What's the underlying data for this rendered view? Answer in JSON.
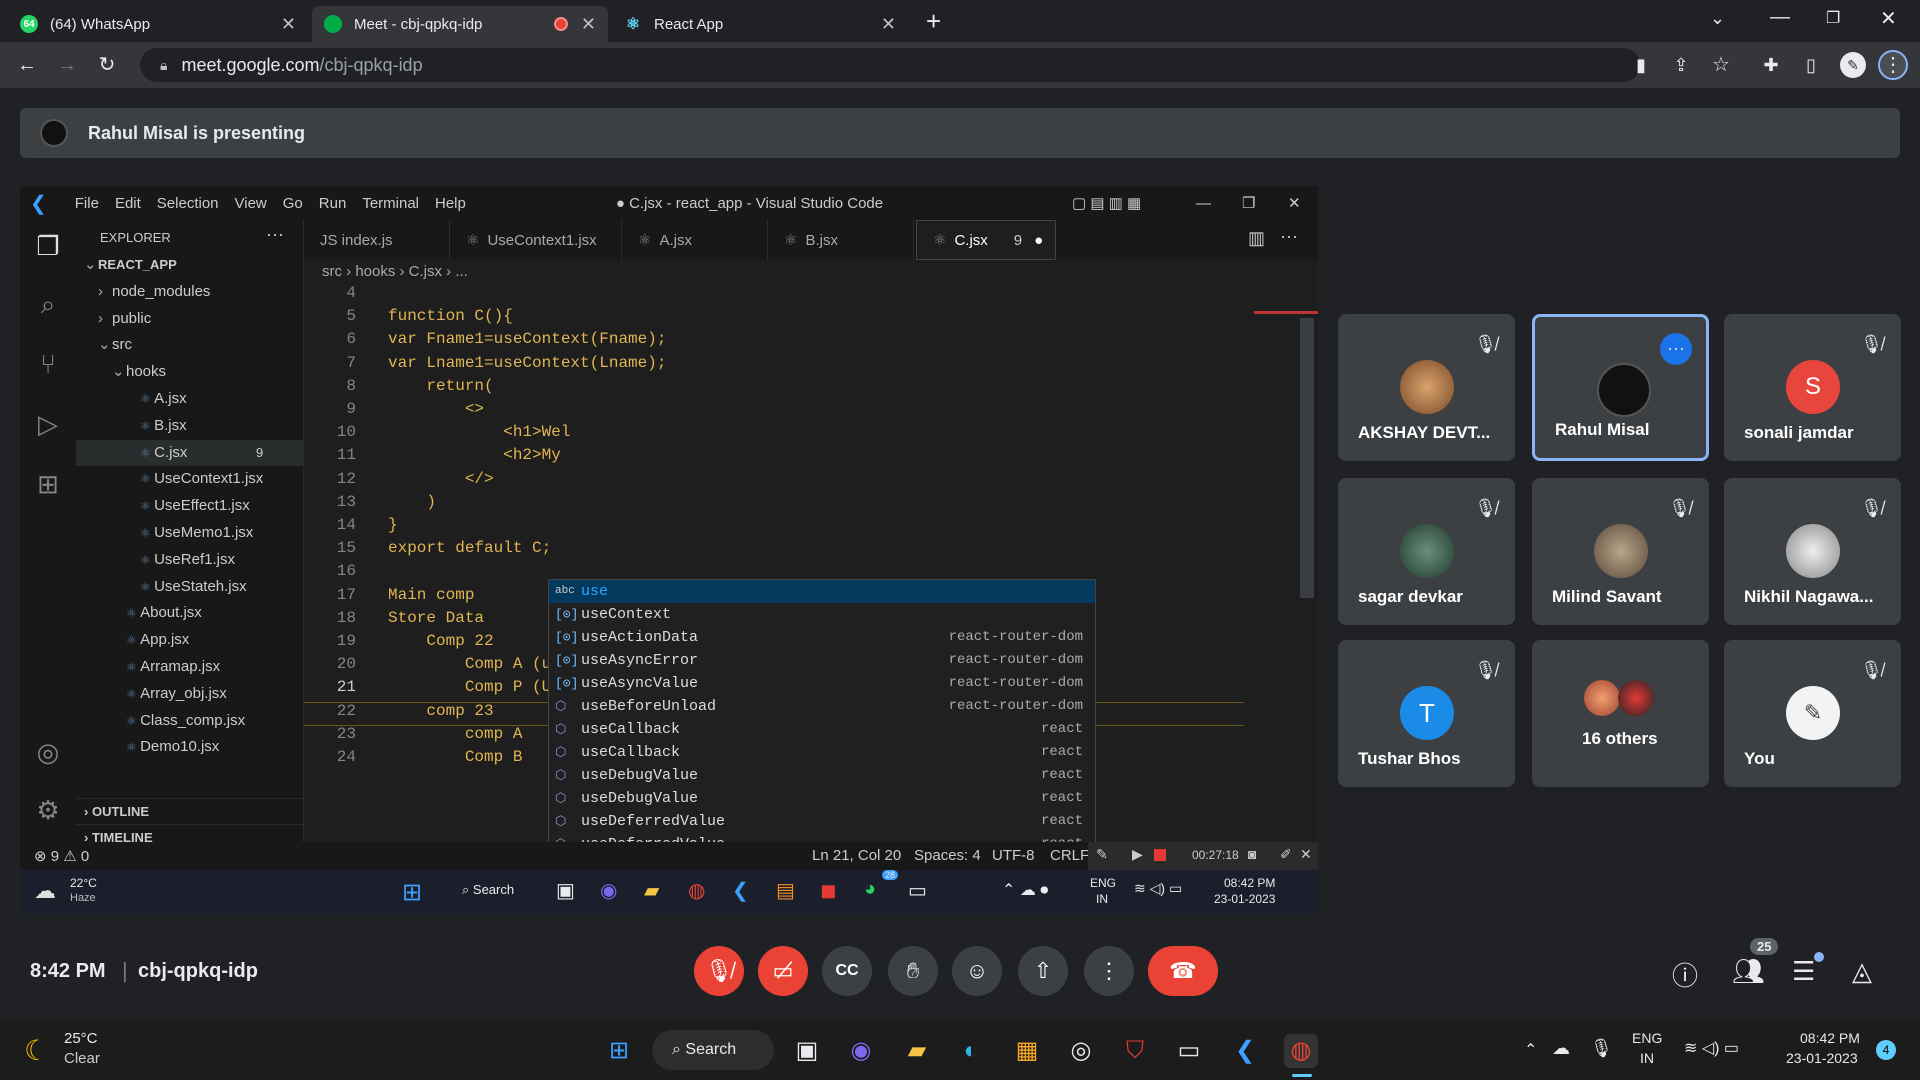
{
  "browser": {
    "tabs": [
      {
        "title": "(64) WhatsApp",
        "favicon": "whatsapp-icon"
      },
      {
        "title": "Meet - cbj-qpkq-idp",
        "favicon": "meet-icon"
      },
      {
        "title": "React App",
        "favicon": "react-icon"
      }
    ],
    "url_host": "meet.google.com",
    "url_path": "/cbj-qpkq-idp"
  },
  "meet": {
    "presenting_text": "Rahul Misal is presenting",
    "time": "8:42 PM",
    "meeting_code": "cbj-qpkq-idp",
    "people_count": "25",
    "participants": [
      {
        "name": "AKSHAY DEVT...",
        "muted": true
      },
      {
        "name": "Rahul Misal",
        "muted": false
      },
      {
        "name": "sonali jamdar",
        "initial": "S",
        "muted": true
      },
      {
        "name": "sagar devkar",
        "muted": true
      },
      {
        "name": "Milind Savant",
        "muted": true
      },
      {
        "name": "Nikhil Nagawa...",
        "muted": true
      },
      {
        "name": "Tushar Bhos",
        "initial": "T",
        "muted": true
      },
      {
        "name": "16 others"
      },
      {
        "name": "You",
        "muted": true
      }
    ]
  },
  "vscode": {
    "menu": [
      "File",
      "Edit",
      "Selection",
      "View",
      "Go",
      "Run",
      "Terminal",
      "Help"
    ],
    "title": "● C.jsx - react_app - Visual Studio Code",
    "explorer_title": "EXPLORER",
    "tree": [
      {
        "label": "REACT_APP",
        "indent": 0,
        "arrow": "⌄"
      },
      {
        "label": "node_modules",
        "indent": 1,
        "arrow": "›"
      },
      {
        "label": "public",
        "indent": 1,
        "arrow": "›"
      },
      {
        "label": "src",
        "indent": 1,
        "arrow": "⌄"
      },
      {
        "label": "hooks",
        "indent": 2,
        "arrow": "⌄"
      },
      {
        "label": "A.jsx",
        "indent": 3
      },
      {
        "label": "B.jsx",
        "indent": 3
      },
      {
        "label": "C.jsx",
        "indent": 3,
        "badge": "9"
      },
      {
        "label": "UseContext1.jsx",
        "indent": 3
      },
      {
        "label": "UseEffect1.jsx",
        "indent": 3
      },
      {
        "label": "UseMemo1.jsx",
        "indent": 3
      },
      {
        "label": "UseRef1.jsx",
        "indent": 3
      },
      {
        "label": "UseStateh.jsx",
        "indent": 3
      },
      {
        "label": "About.jsx",
        "indent": 2
      },
      {
        "label": "App.jsx",
        "indent": 2
      },
      {
        "label": "Arramap.jsx",
        "indent": 2
      },
      {
        "label": "Array_obj.jsx",
        "indent": 2
      },
      {
        "label": "Class_comp.jsx",
        "indent": 2
      },
      {
        "label": "Demo10.jsx",
        "indent": 2
      }
    ],
    "outline": "OUTLINE",
    "timeline": "TIMELINE",
    "tabs": [
      {
        "label": "JS index.js"
      },
      {
        "label": "UseContext1.jsx"
      },
      {
        "label": "A.jsx"
      },
      {
        "label": "B.jsx"
      },
      {
        "label": "C.jsx",
        "badge": "9",
        "active": true
      }
    ],
    "breadcrumb": "src › hooks › C.jsx › ...",
    "code_lines": [
      {
        "n": "4",
        "t": ""
      },
      {
        "n": "5",
        "t": "function C(){"
      },
      {
        "n": "6",
        "t": "var Fname1=useContext(Fname);"
      },
      {
        "n": "7",
        "t": "var Lname1=useContext(Lname);"
      },
      {
        "n": "8",
        "t": "    return("
      },
      {
        "n": "9",
        "t": "        <>"
      },
      {
        "n": "10",
        "t": "            <h1>Wel"
      },
      {
        "n": "11",
        "t": "            <h2>My"
      },
      {
        "n": "12",
        "t": "        </>"
      },
      {
        "n": "13",
        "t": "    )"
      },
      {
        "n": "14",
        "t": "}"
      },
      {
        "n": "15",
        "t": "export default C;"
      },
      {
        "n": "16",
        "t": ""
      },
      {
        "n": "17",
        "t": "Main comp"
      },
      {
        "n": "18",
        "t": "Store Data"
      },
      {
        "n": "19",
        "t": "    Comp 22"
      },
      {
        "n": "20",
        "t": "        Comp A (use"
      },
      {
        "n": "21",
        "t": "        Comp P (Use)"
      },
      {
        "n": "22",
        "t": "    comp 23"
      },
      {
        "n": "23",
        "t": "        comp A"
      },
      {
        "n": "24",
        "t": "        Comp B"
      }
    ],
    "suggestions": [
      {
        "kind": "abc",
        "label": "use",
        "source": ""
      },
      {
        "kind": "var",
        "label": "useContext",
        "source": ""
      },
      {
        "kind": "var",
        "label": "useActionData",
        "source": "react-router-dom"
      },
      {
        "kind": "var",
        "label": "useAsyncError",
        "source": "react-router-dom"
      },
      {
        "kind": "var",
        "label": "useAsyncValue",
        "source": "react-router-dom"
      },
      {
        "kind": "mod",
        "label": "useBeforeUnload",
        "source": "react-router-dom"
      },
      {
        "kind": "mod",
        "label": "useCallback",
        "source": "react"
      },
      {
        "kind": "mod",
        "label": "useCallback",
        "source": "react"
      },
      {
        "kind": "mod",
        "label": "useDebugValue",
        "source": "react"
      },
      {
        "kind": "mod",
        "label": "useDebugValue",
        "source": "react"
      },
      {
        "kind": "mod",
        "label": "useDeferredValue",
        "source": "react"
      },
      {
        "kind": "mod",
        "label": "useDeferredValue",
        "source": "react"
      }
    ],
    "status": {
      "problems": "⊗ 9 ⚠ 0",
      "position": "Ln 21, Col 20",
      "spaces": "Spaces: 4",
      "encoding": "UTF-8",
      "eol": "CRLF",
      "record_time": "00:27:18"
    },
    "inner_taskbar": {
      "temp": "22°C",
      "weather": "Haze",
      "search": "Search",
      "lang1": "ENG",
      "lang2": "IN",
      "time": "08:42 PM",
      "date": "23-01-2023",
      "whatsapp_badge": "28"
    }
  },
  "taskbar": {
    "temp": "25°C",
    "weather": "Clear",
    "search": "Search",
    "lang1": "ENG",
    "lang2": "IN",
    "time": "08:42 PM",
    "date": "23-01-2023",
    "notif": "4"
  }
}
